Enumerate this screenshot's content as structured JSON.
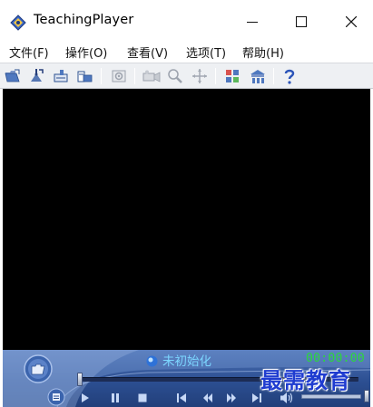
{
  "window": {
    "title": "TeachingPlayer",
    "controls": [
      "minimize-icon",
      "maximize-icon",
      "close-icon"
    ]
  },
  "menu": {
    "file": "文件(F)",
    "operate": "操作(O)",
    "view": "查看(V)",
    "options": "选项(T)",
    "help": "帮助(H)"
  },
  "toolbar": {
    "icons": [
      "open-folder-icon",
      "connect-icon",
      "export-icon",
      "convert-icon",
      "snapshot-icon",
      "record-icon",
      "zoom-icon",
      "move-icon",
      "layout-icon",
      "network-icon",
      "help-icon"
    ]
  },
  "player": {
    "status": "未初始化",
    "time": "00:00:00",
    "seek_progress": 0,
    "volume_level": 1.0,
    "controls": [
      "play-icon",
      "pause-icon",
      "stop-icon",
      "prev-icon",
      "rewind-icon",
      "forward-icon",
      "next-icon",
      "speaker-icon"
    ]
  },
  "watermark": {
    "text": "最需教育"
  },
  "colors": {
    "panel": "#2c4f92",
    "status_text": "#7cd6ff",
    "time_text": "#2bd93a",
    "watermark": "#1f3cd0"
  }
}
